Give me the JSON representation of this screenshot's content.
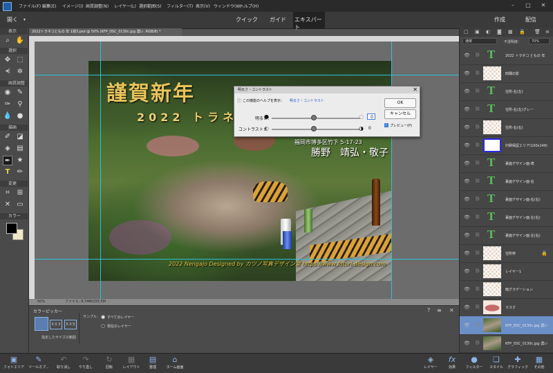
{
  "menu": [
    "ファイル(F)",
    "編集(E)",
    "イメージ(I)",
    "画質調整(N)",
    "レイヤー(L)",
    "選択範囲(S)",
    "フィルター(T)",
    "表示(V)",
    "ウィンドウ(W)",
    "ヘルプ(H)"
  ],
  "modebar": {
    "open": "開く",
    "quick": "クイック",
    "guide": "ガイド",
    "expert": "エキスパート",
    "create": "作成",
    "share": "配信"
  },
  "toolbox": {
    "sections": [
      "表示",
      "選択",
      "画質調整",
      "描画",
      "変更",
      "カラー"
    ]
  },
  "document": {
    "tab": "2022トラネコともの 年 1週3.psd @ 50% (KFP_DSC_0130c.jpg 濃い, RGB/8) *",
    "status_zoom": "50%",
    "status_file": "ファイル: 8.74M/155.5M"
  },
  "image_text": {
    "title": "謹賀新年",
    "year": "2022 トラネ",
    "address": "福岡市博多区竹下 5-17-23",
    "names": "勝野　靖弘・敬子",
    "credit": "2022 Nengajo Designed by  カツノ写真デザイン室  https://www.fotori-design.com"
  },
  "dialog": {
    "title": "明るさ・コントラスト",
    "help_prefix": "この機能のヘルプを表示：",
    "help_link": "明るさ・コントラスト",
    "brightness_label": "明るさ：",
    "brightness_value": "0",
    "contrast_label": "コントラスト：",
    "contrast_value": "0",
    "ok": "OK",
    "cancel": "キャンセル",
    "preview": "プレビュー(P)"
  },
  "options": {
    "section": "カラーピッカー",
    "size1": "3 X 3",
    "size2": "5 X 5",
    "sample_caption": "指定したサイズの範囲",
    "sample_label": "サンプル：",
    "opt_all": "すべてのレイヤー",
    "opt_current": "現在のレイヤー"
  },
  "layers_panel": {
    "blend_mode": "通常",
    "opacity_label": "不透明度：",
    "opacity_value": "70%",
    "layers": [
      {
        "name": "2022 トラネコ ともの 年",
        "type": "text"
      },
      {
        "name": "四隅の影",
        "type": "pixel"
      },
      {
        "name": "住所-右(左)",
        "type": "text"
      },
      {
        "name": "住所-右(左)グレー",
        "type": "text"
      },
      {
        "name": "住所-右(右)",
        "type": "pixel"
      },
      {
        "name": "印刷保証エリア(100x148)",
        "type": "frame"
      },
      {
        "name": "裏面デザイン面-表",
        "type": "text"
      },
      {
        "name": "裏面デザイン面-右",
        "type": "text"
      },
      {
        "name": "裏面デザイン面-右(右)",
        "type": "text"
      },
      {
        "name": "裏面デザイン面-左(右)",
        "type": "text"
      },
      {
        "name": "裏面デザイン面-左(右)",
        "type": "text"
      },
      {
        "name": "住所枠",
        "type": "pixel",
        "locked": true
      },
      {
        "name": "レイヤー1",
        "type": "pixel"
      },
      {
        "name": "暗グラデーション",
        "type": "pixel"
      },
      {
        "name": "マスク",
        "type": "mask"
      },
      {
        "name": "KFP_DSC_0130c.jpg 濃い",
        "type": "photo",
        "selected": true
      },
      {
        "name": "KFP_DSC_0130c.jpg 濃い",
        "type": "photo"
      },
      {
        "name": "KFP_DSC_0130c.jpg 濃い",
        "type": "photo"
      }
    ]
  },
  "bottom_bar": {
    "left": [
      "フォトエリア",
      "ツールオプ...",
      "取り消し",
      "やり直し",
      "回転",
      "レイアウト",
      "整理",
      "ホーム画面"
    ],
    "right": [
      "レイヤー",
      "効果",
      "フィルター",
      "スタイル",
      "グラフィック",
      "その他"
    ]
  },
  "colors": {
    "accent": "#2ac3d6",
    "selected_layer": "#6b8fc7",
    "text_layer_icon": "#5cb85c"
  }
}
